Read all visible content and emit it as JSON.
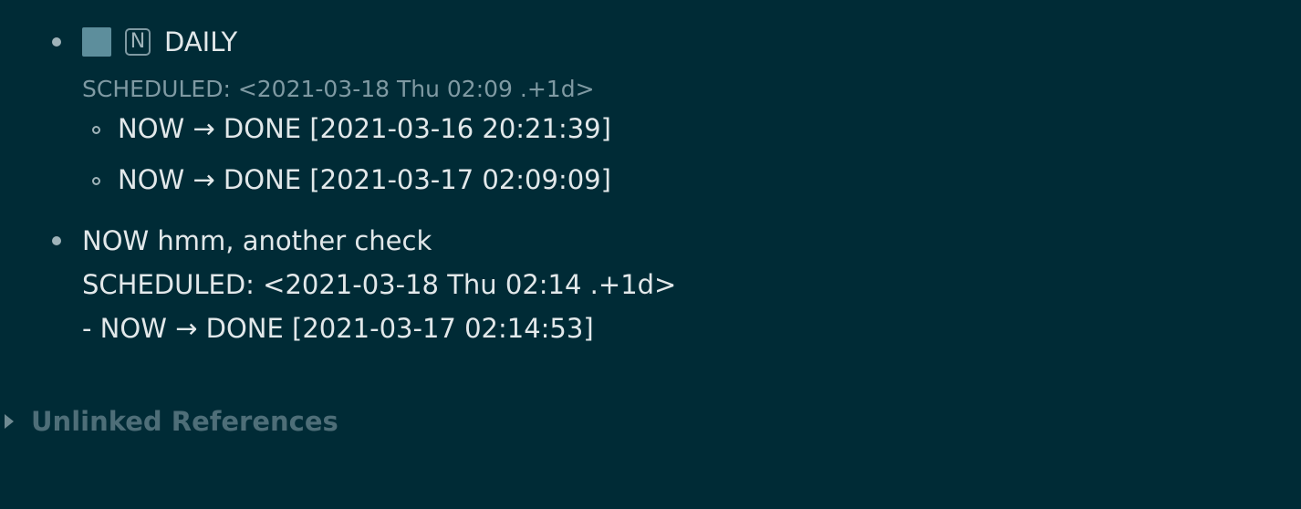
{
  "blocks": [
    {
      "title": "DAILY",
      "marker": "N",
      "scheduled": "SCHEDULED: <2021-03-18 Thu 02:09 .+1d>",
      "children": [
        {
          "text": "NOW → DONE [2021-03-16 20:21:39]"
        },
        {
          "text": "NOW → DONE [2021-03-17 02:09:09]"
        }
      ]
    },
    {
      "lines": [
        "NOW hmm, another check",
        "SCHEDULED: <2021-03-18 Thu 02:14 .+1d>",
        "- NOW → DONE [2021-03-17 02:14:53]"
      ]
    }
  ],
  "unlinked": {
    "label": "Unlinked References"
  },
  "icons": {
    "bullet": "bullet-dot-icon",
    "checkbox": "checkbox-icon",
    "marker": "n-marker-icon",
    "collapse": "triangle-right-icon"
  },
  "colors": {
    "background": "#002b36",
    "text": "#e2e8ea",
    "muted": "#7f9aa3",
    "checkbox": "#5d8e9c"
  }
}
